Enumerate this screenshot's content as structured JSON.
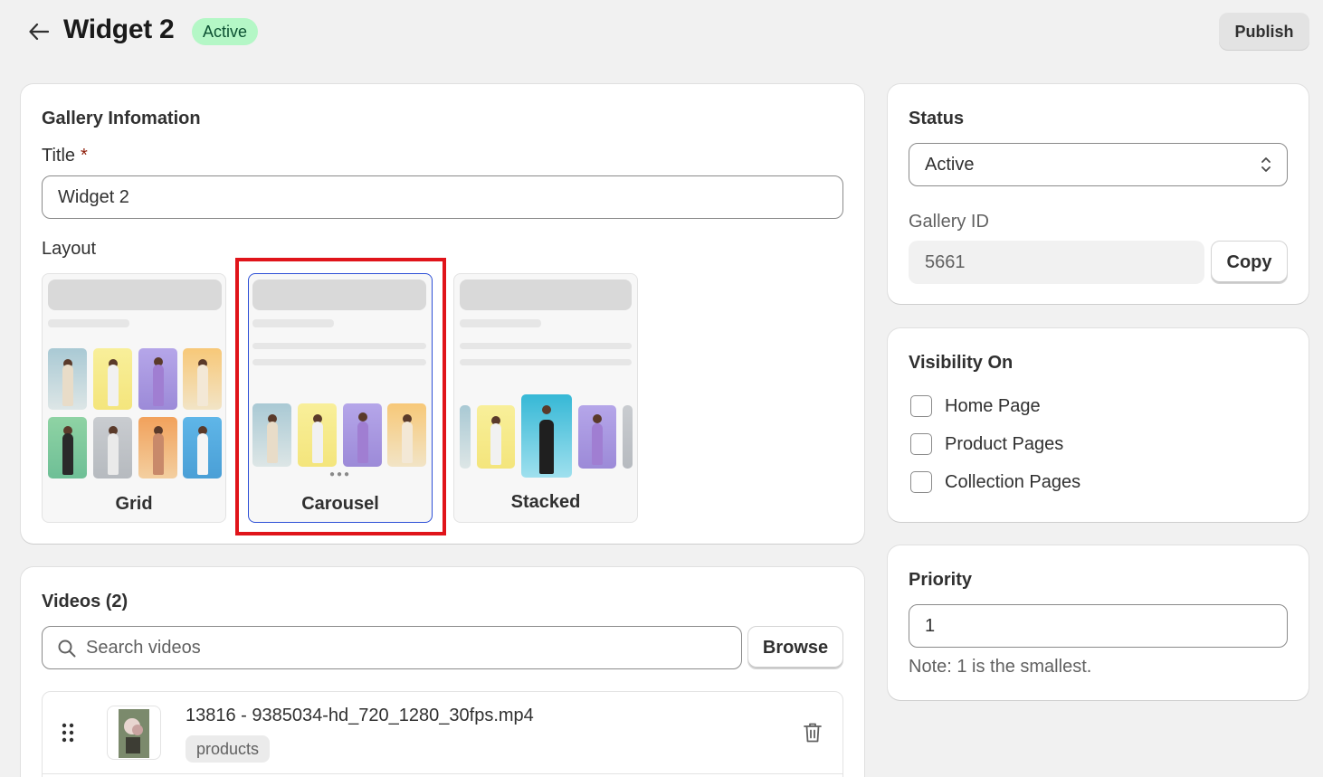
{
  "header": {
    "title": "Widget 2",
    "status_badge": "Active",
    "publish_label": "Publish"
  },
  "gallery_info": {
    "card_title": "Gallery Infomation",
    "title_label": "Title",
    "required_mark": "*",
    "title_value": "Widget 2",
    "layout_label": "Layout",
    "layouts": [
      {
        "label": "Grid",
        "selected": false
      },
      {
        "label": "Carousel",
        "selected": true
      },
      {
        "label": "Stacked",
        "selected": false
      }
    ]
  },
  "status": {
    "card_title": "Status",
    "selected": "Active",
    "gallery_id_label": "Gallery ID",
    "gallery_id": "5661",
    "copy_label": "Copy"
  },
  "visibility": {
    "card_title": "Visibility On",
    "options": [
      {
        "label": "Home Page",
        "checked": false
      },
      {
        "label": "Product Pages",
        "checked": false
      },
      {
        "label": "Collection Pages",
        "checked": false
      }
    ]
  },
  "priority": {
    "card_title": "Priority",
    "value": "1",
    "note": "Note: 1 is the smallest."
  },
  "videos": {
    "card_title": "Videos (2)",
    "search_placeholder": "Search videos",
    "browse_label": "Browse",
    "items": [
      {
        "filename": "13816 - 9385034-hd_720_1280_30fps.mp4",
        "tag": "products"
      }
    ]
  },
  "colors": {
    "accent_selected": "#2c4fd6",
    "highlight": "#e0141a",
    "badge_bg": "#b4f7c6",
    "badge_text": "#0c5132"
  },
  "icons": [
    "arrow-left-icon",
    "select-caret-icon",
    "search-icon",
    "drag-handle-icon",
    "trash-icon"
  ]
}
